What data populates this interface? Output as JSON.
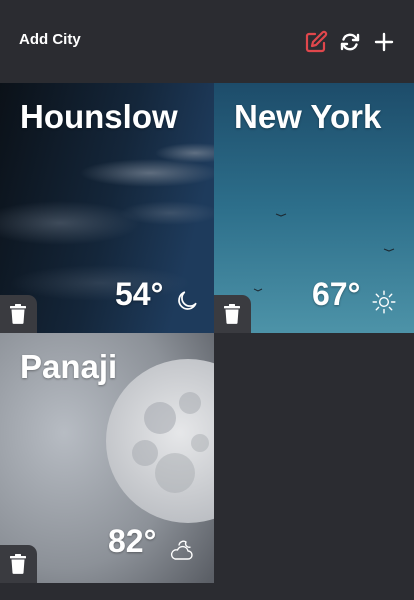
{
  "header": {
    "add_city_label": "Add City",
    "edit_icon": "edit-icon",
    "refresh_icon": "refresh-icon",
    "add_icon": "plus-icon",
    "accent_color": "#e0474c"
  },
  "cities": [
    {
      "name": "Hounslow",
      "temp": "54°",
      "condition_icon": "moon-icon"
    },
    {
      "name": "New York",
      "temp": "67°",
      "condition_icon": "sun-icon"
    },
    {
      "name": "Panaji",
      "temp": "82°",
      "condition_icon": "cloudy-night-icon"
    }
  ],
  "colors": {
    "background": "#2b2c31",
    "text": "#ffffff",
    "trash_button": "#3a3b40"
  }
}
